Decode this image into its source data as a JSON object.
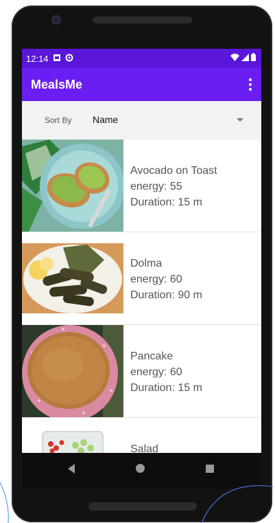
{
  "status_bar": {
    "time": "12:14",
    "icons": [
      "notification-icon",
      "sync-icon",
      "wifi-icon",
      "signal-icon",
      "battery-icon"
    ]
  },
  "app_bar": {
    "title": "MealsMe",
    "menu_icon": "more-vert-icon"
  },
  "sort": {
    "label": "Sort By",
    "selected": "Name",
    "icon": "arrow-drop-down-icon"
  },
  "meals": [
    {
      "name": "Avocado on Toast",
      "energy": "energy: 55",
      "duration": "Duration: 15 m",
      "image": "avocado-toast-photo"
    },
    {
      "name": "Dolma",
      "energy": "energy: 60",
      "duration": "Duration: 90 m",
      "image": "dolma-photo"
    },
    {
      "name": "Pancake",
      "energy": "energy: 60",
      "duration": "Duration: 15 m",
      "image": "pancake-photo"
    },
    {
      "name": "Salad",
      "energy": "",
      "duration": "",
      "image": "salad-photo"
    }
  ],
  "nav_bar": {
    "icons": [
      "back-icon",
      "home-icon",
      "recents-icon"
    ]
  },
  "colors": {
    "status_bar": "#5a16d9",
    "app_bar": "#6a1ef2",
    "list_background": "#ffffff",
    "text": "#555555"
  }
}
